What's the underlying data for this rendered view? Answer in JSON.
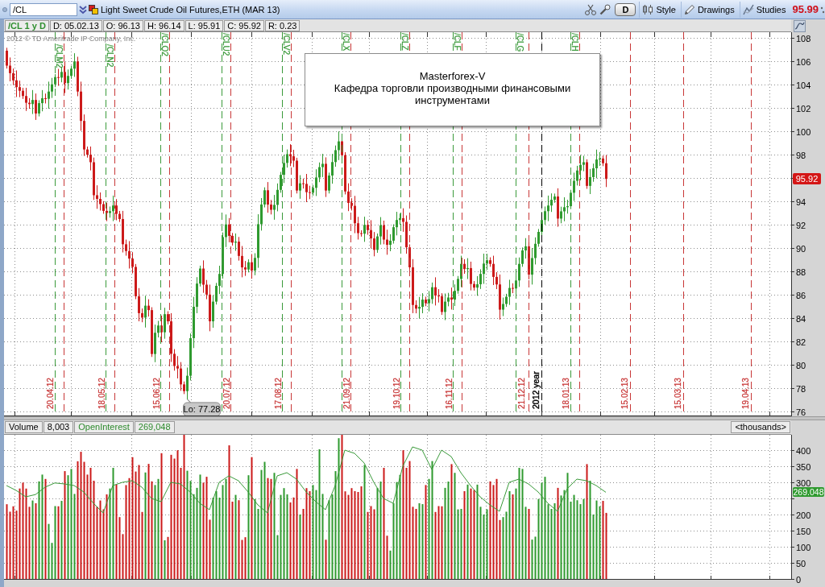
{
  "toolbar": {
    "symbol": "/CL",
    "title": "Light Sweet Crude Oil Futures,ETH (MAR 13)",
    "buttons": [
      {
        "kind": "period",
        "label": "D"
      },
      {
        "kind": "style",
        "label": "Style"
      },
      {
        "kind": "drawings",
        "label": "Drawings"
      },
      {
        "kind": "studies",
        "label": "Studies"
      }
    ],
    "last_price": "95.99"
  },
  "quote_bar": [
    {
      "kind": "symbol",
      "text": "/CL 1 y D"
    },
    {
      "kind": "field",
      "text": "D: 05.02.13"
    },
    {
      "kind": "field",
      "text": "O: 96.13"
    },
    {
      "kind": "field",
      "text": "H: 96.14"
    },
    {
      "kind": "field",
      "text": "L: 95.91"
    },
    {
      "kind": "field",
      "text": "C: 95.92"
    },
    {
      "kind": "field",
      "text": "R: 0.23"
    }
  ],
  "price_chart": {
    "copyright": "2012 © TD Ameritrade IP Company, Inc.",
    "markers": [
      {
        "kind": "contract",
        "label": "/CLM2",
        "color": "#3a9a3a"
      },
      {
        "kind": "date",
        "label": "20.04.12",
        "color": "#c83737"
      },
      {
        "kind": "contract",
        "label": "/CLN2",
        "color": "#3a9a3a"
      },
      {
        "kind": "date",
        "label": "18.05.12",
        "color": "#c83737"
      },
      {
        "kind": "contract",
        "label": "/CLQ2",
        "color": "#3a9a3a"
      },
      {
        "kind": "date",
        "label": "15.06.12",
        "color": "#c83737"
      },
      {
        "kind": "contract",
        "label": "/CLU2",
        "color": "#3a9a3a"
      },
      {
        "kind": "date",
        "label": "20.07.12",
        "color": "#c83737"
      },
      {
        "kind": "contract",
        "label": "/CLV2",
        "color": "#3a9a3a"
      },
      {
        "kind": "date",
        "label": "17.08.12",
        "color": "#c83737"
      },
      {
        "kind": "contract",
        "label": "/CLX",
        "color": "#3a9a3a"
      },
      {
        "kind": "date",
        "label": "21.09.12",
        "color": "#c83737"
      },
      {
        "kind": "contract",
        "label": "/CLZ",
        "color": "#3a9a3a"
      },
      {
        "kind": "date",
        "label": "19.10.12",
        "color": "#c83737"
      },
      {
        "kind": "contract",
        "label": "/CLF",
        "color": "#3a9a3a"
      },
      {
        "kind": "date",
        "label": "16.11.12",
        "color": "#c83737"
      },
      {
        "kind": "contract",
        "label": "/CLG",
        "color": "#3a9a3a"
      },
      {
        "kind": "date",
        "label": "21.12.12",
        "color": "#c83737"
      },
      {
        "kind": "year",
        "label": "2012 year",
        "color": "#000000"
      },
      {
        "kind": "contract",
        "label": "/CLH",
        "color": "#3a9a3a"
      },
      {
        "kind": "date",
        "label": "18.01.13",
        "color": "#c83737"
      },
      {
        "kind": "date",
        "label": "15.02.13",
        "color": "#c83737"
      },
      {
        "kind": "date",
        "label": "15.03.13",
        "color": "#c83737"
      },
      {
        "kind": "date",
        "label": "19.04.13",
        "color": "#c83737"
      }
    ],
    "note": {
      "title": "Masterforex-V",
      "text": "Кафедра торговли производными финансовыми инструментами"
    },
    "low_label": "Lo: 77.28",
    "last_price_badge": "95.92",
    "axis_labels": [
      "108",
      "106",
      "104",
      "102",
      "100",
      "98",
      "94",
      "92",
      "90",
      "88",
      "86",
      "84",
      "82",
      "80",
      "78",
      "76"
    ]
  },
  "volume_panel": {
    "legend": [
      {
        "name": "Volume",
        "value": "8,003",
        "color": "#000000"
      },
      {
        "name": "OpenInterest",
        "value": "269,048",
        "color": "#2e8b2e"
      }
    ],
    "units": "<thousands>",
    "open_interest_badge": "269.048",
    "axis_labels": [
      "400",
      "350",
      "300",
      "200",
      "150",
      "100",
      "50",
      "0"
    ]
  }
}
